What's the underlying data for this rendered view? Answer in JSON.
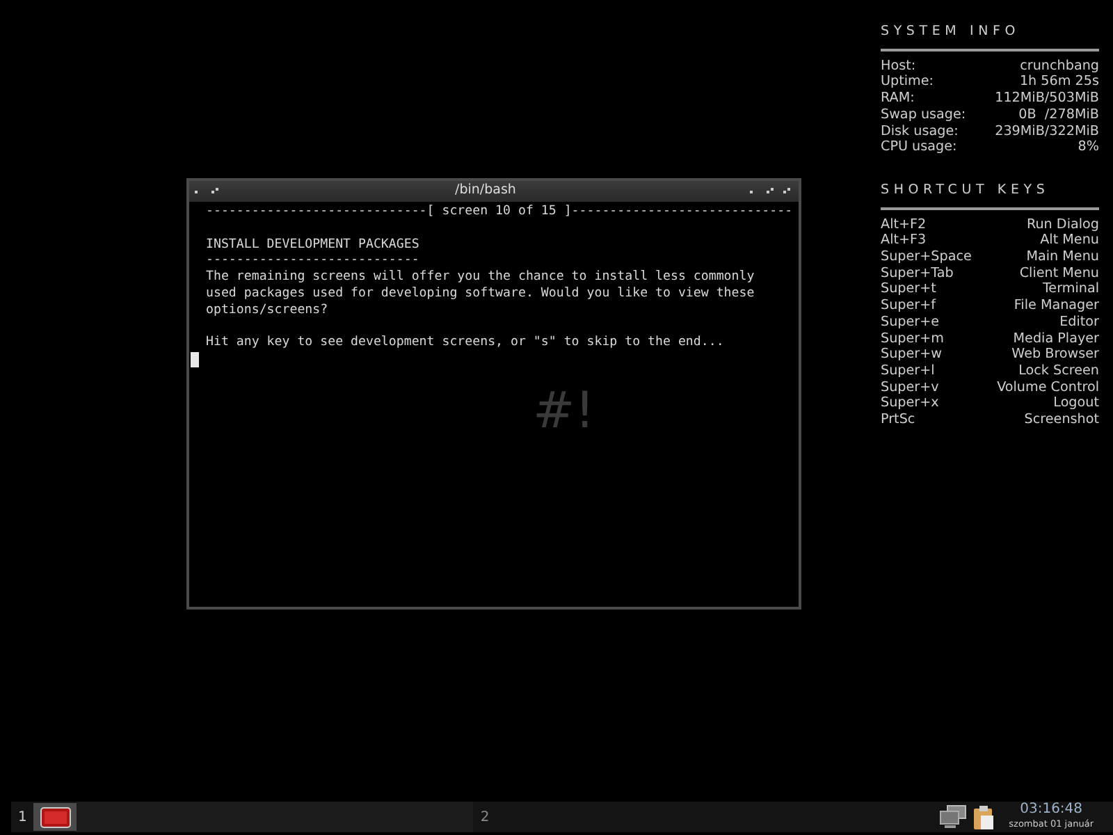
{
  "system_info": {
    "title": "SYSTEM INFO",
    "rows": [
      {
        "label": "Host:",
        "value": "crunchbang"
      },
      {
        "label": "Uptime:",
        "value": "1h 56m 25s"
      },
      {
        "label": "RAM:",
        "value": "112MiB/503MiB"
      },
      {
        "label": "Swap usage:",
        "value": "0B  /278MiB"
      },
      {
        "label": "Disk usage:",
        "value": "239MiB/322MiB"
      },
      {
        "label": "CPU usage:",
        "value": "8%"
      }
    ]
  },
  "shortcut_keys": {
    "title": "SHORTCUT KEYS",
    "rows": [
      {
        "label": "Alt+F2",
        "value": "Run Dialog"
      },
      {
        "label": "Alt+F3",
        "value": "Alt Menu"
      },
      {
        "label": "Super+Space",
        "value": "Main Menu"
      },
      {
        "label": "Super+Tab",
        "value": "Client Menu"
      },
      {
        "label": "Super+t",
        "value": "Terminal"
      },
      {
        "label": "Super+f",
        "value": "File Manager"
      },
      {
        "label": "Super+e",
        "value": "Editor"
      },
      {
        "label": "Super+m",
        "value": "Media Player"
      },
      {
        "label": "Super+w",
        "value": "Web Browser"
      },
      {
        "label": "Super+l",
        "value": "Lock Screen"
      },
      {
        "label": "Super+v",
        "value": "Volume Control"
      },
      {
        "label": "Super+x",
        "value": "Logout"
      },
      {
        "label": "PrtSc",
        "value": "Screenshot"
      }
    ]
  },
  "window": {
    "title": "/bin/bash",
    "blocks": [
      [
        "-----------------------------[ screen 10 of 15 ]-----------------------------"
      ],
      [
        "INSTALL DEVELOPMENT PACKAGES",
        "----------------------------",
        "The remaining screens will offer you the chance to install less commonly",
        "used packages used for developing software. Would you like to view these",
        "options/screens?"
      ],
      [
        "Hit any key to see development screens, or \"s\" to skip to the end..."
      ]
    ]
  },
  "desktop_logo": "#!",
  "taskbar": {
    "workspaces": [
      {
        "label": "1",
        "selected": true
      },
      {
        "label": "2",
        "selected": false
      }
    ],
    "clock": {
      "time": "03:16:48",
      "date": "szombat 01 január"
    }
  }
}
